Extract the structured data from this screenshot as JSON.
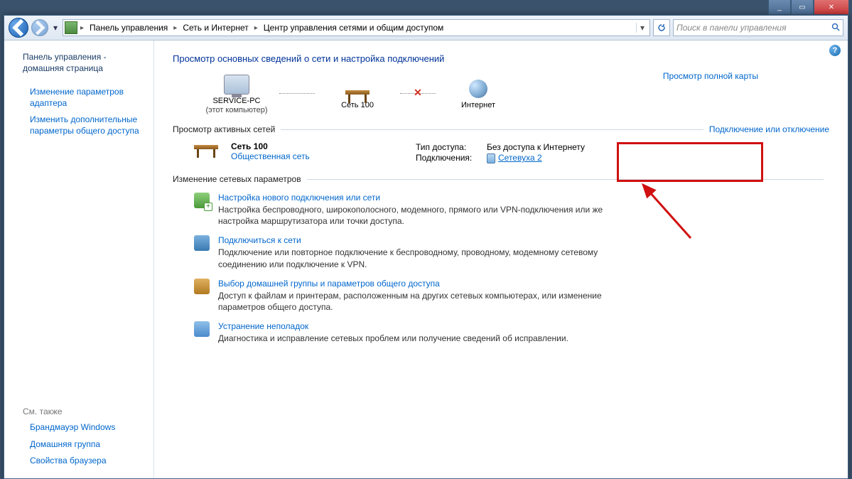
{
  "window_controls": {
    "min": "_",
    "max": "▭",
    "close": "✕"
  },
  "nav": {
    "crumbs": [
      "Панель управления",
      "Сеть и Интернет",
      "Центр управления сетями и общим доступом"
    ],
    "search_placeholder": "Поиск в панели управления"
  },
  "sidebar": {
    "home": "Панель управления - домашняя страница",
    "links": [
      "Изменение параметров адаптера",
      "Изменить дополнительные параметры общего доступа"
    ],
    "also_head": "См. также",
    "also": [
      "Брандмауэр Windows",
      "Домашняя группа",
      "Свойства браузера"
    ]
  },
  "main": {
    "title": "Просмотр основных сведений о сети и настройка подключений",
    "map": {
      "pc_name": "SERVICE-PC",
      "pc_sub": "(этот компьютер)",
      "net_name": "Сеть  100",
      "internet": "Интернет",
      "full_map_link": "Просмотр полной карты"
    },
    "active": {
      "section": "Просмотр активных сетей",
      "section_right": "Подключение или отключение",
      "name": "Сеть  100",
      "type": "Общественная сеть",
      "access_label": "Тип доступа:",
      "access_value": "Без доступа к Интернету",
      "conn_label": "Подключения:",
      "conn_value": "Сетевуха 2"
    },
    "params_head": "Изменение сетевых параметров",
    "tasks": [
      {
        "title": "Настройка нового подключения или сети",
        "desc": "Настройка беспроводного, широкополосного, модемного, прямого или VPN-подключения или же настройка маршрутизатора или точки доступа.",
        "ico": "green"
      },
      {
        "title": "Подключиться к сети",
        "desc": "Подключение или повторное подключение к беспроводному, проводному, модемному сетевому соединению или подключение к VPN.",
        "ico": "conn"
      },
      {
        "title": "Выбор домашней группы и параметров общего доступа",
        "desc": "Доступ к файлам и принтерам, расположенным на других сетевых компьютерах, или изменение параметров общего доступа.",
        "ico": "home"
      },
      {
        "title": "Устранение неполадок",
        "desc": "Диагностика и исправление сетевых проблем или получение сведений об исправлении.",
        "ico": "diag"
      }
    ]
  }
}
